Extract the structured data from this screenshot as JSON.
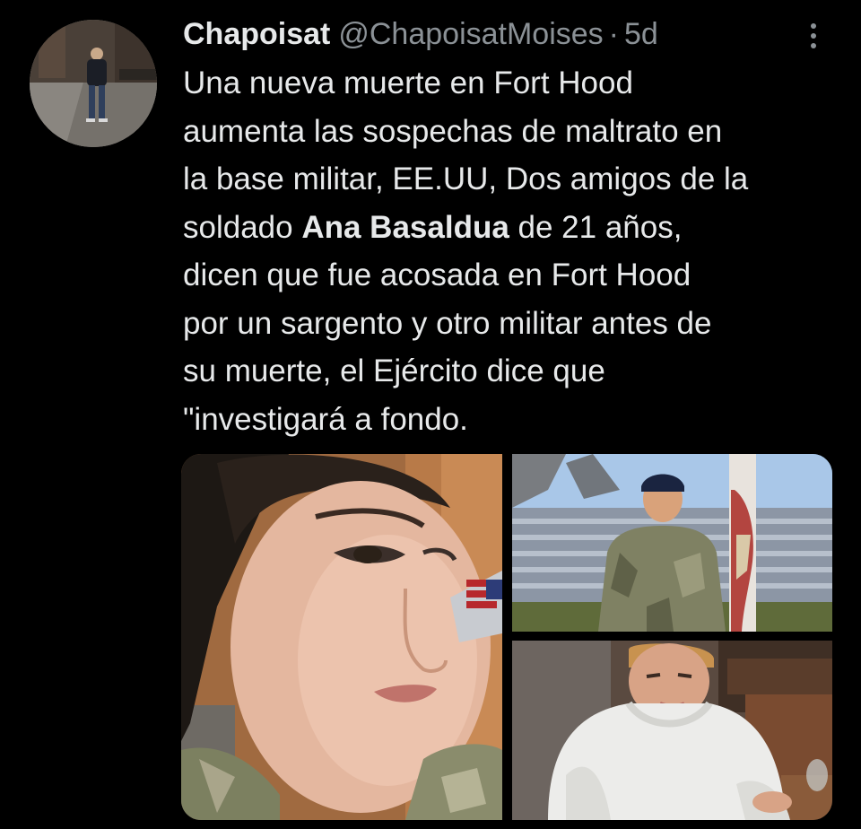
{
  "tweet": {
    "display_name": "Chapoisat",
    "handle": "@ChapoisatMoises",
    "separator": "·",
    "time": "5d",
    "text_lines": [
      {
        "before": "Una nueva muerte en Fort Hood",
        "bold": "",
        "after": ""
      },
      {
        "before": "aumenta las sospechas de maltrato en",
        "bold": "",
        "after": ""
      },
      {
        "before": "la base militar, EE.UU, Dos amigos de la",
        "bold": "",
        "after": ""
      },
      {
        "before": "soldado ",
        "bold": "Ana Basaldua",
        "after": " de 21 años,"
      },
      {
        "before": "dicen que fue acosada en Fort Hood",
        "bold": "",
        "after": ""
      },
      {
        "before": "por un sargento y otro militar antes de",
        "bold": "",
        "after": ""
      },
      {
        "before": "su muerte, el Ejército dice que",
        "bold": "",
        "after": ""
      },
      {
        "before": "\"investigará a fondo.",
        "bold": "",
        "after": ""
      }
    ]
  },
  "media": {
    "photos": [
      "photo-portrait-closeup",
      "photo-soldier-bleachers",
      "photo-white-sweater"
    ]
  },
  "colors": {
    "background": "#000000",
    "primary_text": "#e7e9ea",
    "secondary_text": "#8b9196"
  }
}
